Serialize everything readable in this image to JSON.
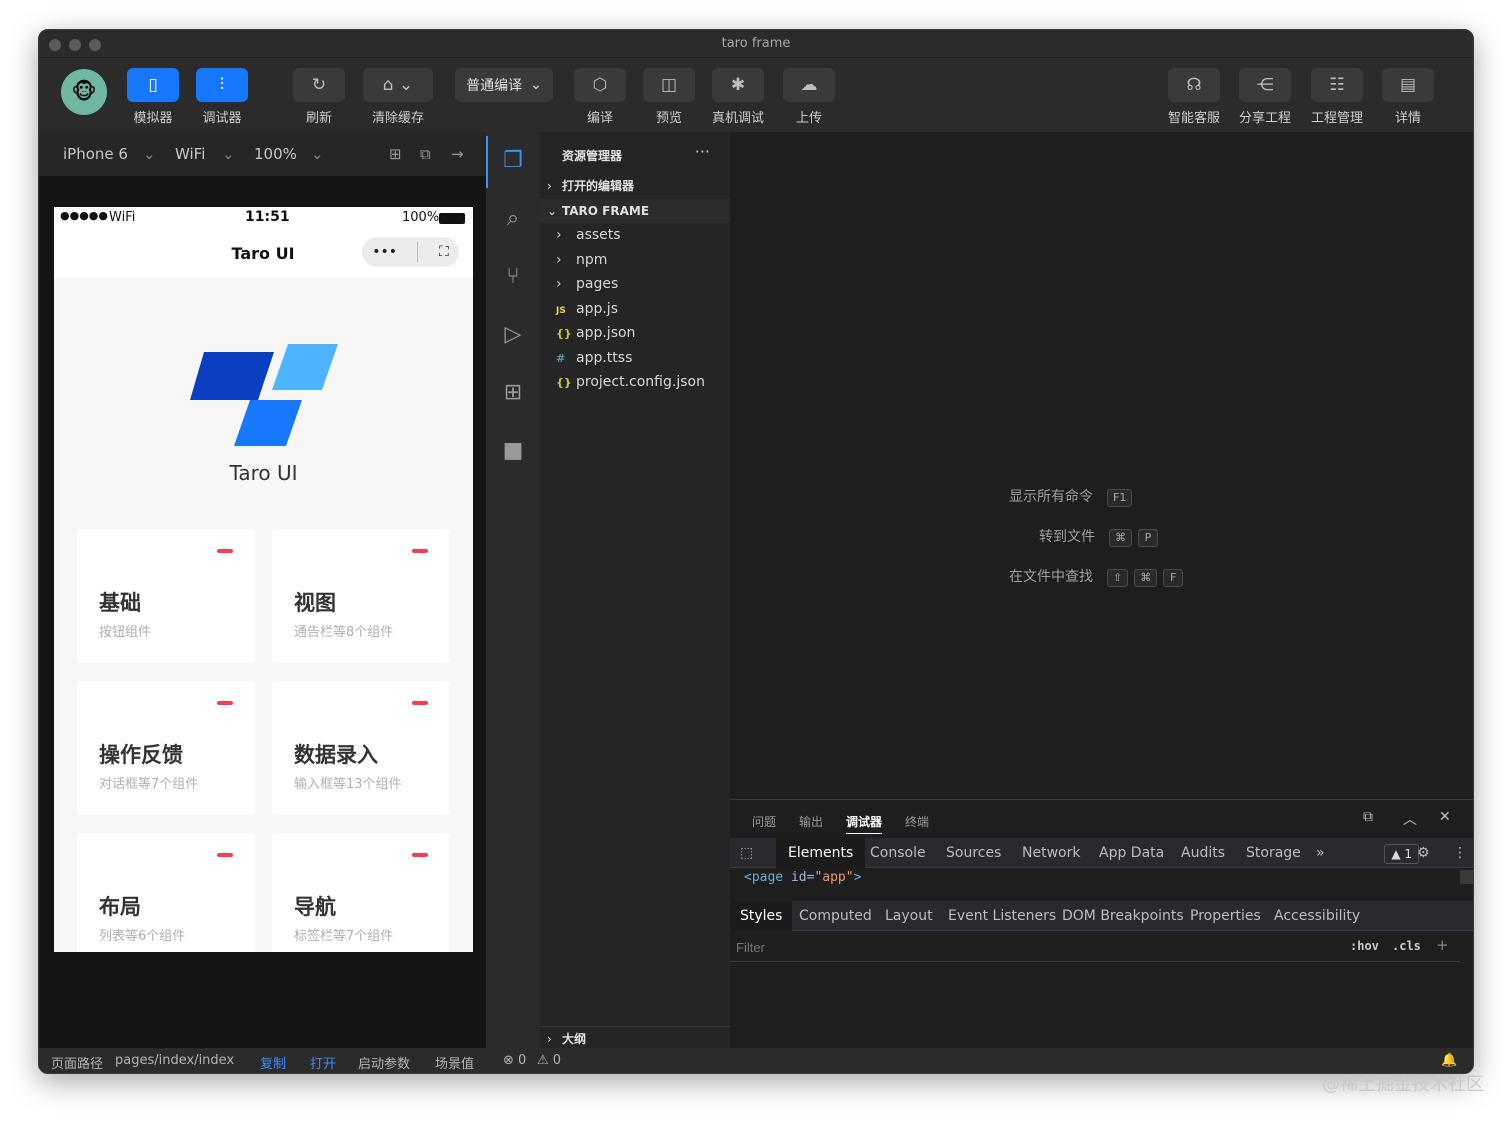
{
  "window": {
    "title": "taro frame"
  },
  "toolbar": {
    "simulator": "模拟器",
    "debugger": "调试器",
    "refresh": "刷新",
    "clear_cache": "清除缓存",
    "compile_mode": "普通编译",
    "compile": "编译",
    "preview": "预览",
    "device_debug": "真机调试",
    "upload": "上传",
    "support": "智能客服",
    "share": "分享工程",
    "project_mgmt": "工程管理",
    "details": "详情"
  },
  "sim": {
    "device": "iPhone 6",
    "network": "WiFi",
    "zoom": "100%"
  },
  "phone": {
    "signal": "●●●●●",
    "wifi": "WiFi",
    "time": "11:51",
    "battery": "100%",
    "nav_title": "Taro UI",
    "capsule_more": "•••",
    "logo_text": "Taro UI",
    "cards": [
      {
        "title": "基础",
        "subtitle": "按钮组件"
      },
      {
        "title": "视图",
        "subtitle": "通告栏等8个组件"
      },
      {
        "title": "操作反馈",
        "subtitle": "对话框等7个组件"
      },
      {
        "title": "数据录入",
        "subtitle": "输入框等13个组件"
      },
      {
        "title": "布局",
        "subtitle": "列表等6个组件"
      },
      {
        "title": "导航",
        "subtitle": "标签栏等7个组件"
      }
    ]
  },
  "explorer": {
    "header": "资源管理器",
    "more": "···",
    "open_editors": "打开的编辑器",
    "project": "TARO FRAME",
    "outline": "大纲",
    "files": [
      {
        "icon": "›",
        "name": "assets"
      },
      {
        "icon": "›",
        "name": "npm"
      },
      {
        "icon": "›",
        "name": "pages"
      },
      {
        "icon": "JS",
        "name": "app.js"
      },
      {
        "icon": "{}",
        "name": "app.json"
      },
      {
        "icon": "#",
        "name": "app.ttss"
      },
      {
        "icon": "{}",
        "name": "project.config.json"
      }
    ]
  },
  "editor": {
    "commands": [
      {
        "label": "显示所有命令",
        "keys": [
          "F1"
        ]
      },
      {
        "label": "转到文件",
        "keys": [
          "⌘",
          "P"
        ]
      },
      {
        "label": "在文件中查找",
        "keys": [
          "⇧",
          "⌘",
          "F"
        ]
      }
    ]
  },
  "panel": {
    "tabs": [
      "问题",
      "输出",
      "调试器",
      "终端"
    ],
    "devtools_tabs": [
      "Elements",
      "Console",
      "Sources",
      "Network",
      "App Data",
      "Audits",
      "Storage"
    ],
    "more_tabs": "»",
    "warning_count": "▲ 1",
    "dom_tag_open": "<page",
    "dom_attr_name": "id",
    "dom_attr_value": "\"app\"",
    "dom_tag_close": ">",
    "style_tabs": [
      "Styles",
      "Computed",
      "Layout",
      "Event Listeners",
      "DOM Breakpoints",
      "Properties",
      "Accessibility"
    ],
    "filter_placeholder": "Filter",
    "hov": ":hov",
    "cls": ".cls",
    "plus": "+"
  },
  "statusbar": {
    "path_label": "页面路径",
    "path": "pages/index/index",
    "copy": "复制",
    "open": "打开",
    "launch_params": "启动参数",
    "scene": "场景值",
    "errors": "⊗ 0",
    "warnings": "⚠ 0"
  },
  "watermark": "@稀土掘金技术社区",
  "colors": {
    "accent": "#1677ff",
    "editor_bg": "#1e1e1e",
    "card_dash": "#ff3b4e",
    "link": "#3b8cff"
  }
}
